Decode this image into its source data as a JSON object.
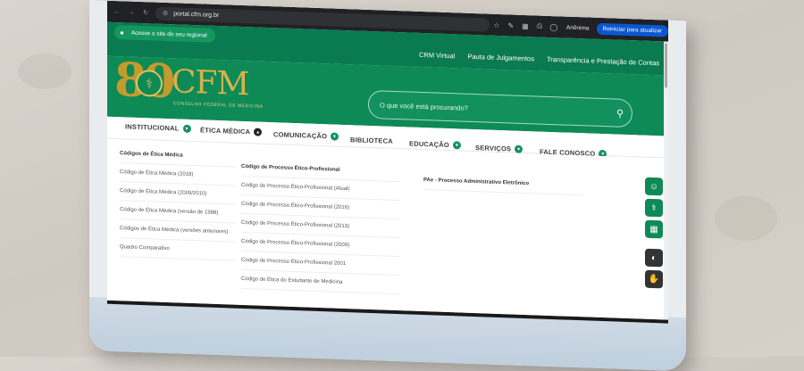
{
  "browser": {
    "url": "portal.cfm.org.br",
    "profile_label": "Anônima",
    "restart_label": "Reiniciar para atualizar"
  },
  "site": {
    "regional_label": "Acesse o site do seu regional",
    "top_links": [
      "CRM Virtual",
      "Pauta de Julgamentos",
      "Transparência e Prestação de Contas"
    ],
    "logo_number": "80",
    "logo_name": "CFM",
    "logo_subtitle": "CONSELHO FEDERAL DE MEDICINA",
    "search_placeholder": "O que você está procurando?"
  },
  "nav": {
    "items": [
      {
        "label": "INSTITUCIONAL",
        "has_chevron": true,
        "open": false
      },
      {
        "label": "ÉTICA MÉDICA",
        "has_chevron": true,
        "open": true
      },
      {
        "label": "COMUNICAÇÃO",
        "has_chevron": true,
        "open": false
      },
      {
        "label": "BIBLIOTECA",
        "has_chevron": false,
        "open": false
      },
      {
        "label": "EDUCAÇÃO",
        "has_chevron": true,
        "open": false
      },
      {
        "label": "SERVIÇOS",
        "has_chevron": true,
        "open": false
      },
      {
        "label": "FALE CONOSCO",
        "has_chevron": true,
        "open": false
      }
    ]
  },
  "dropdown": {
    "col1": {
      "header": "Códigos de Ética Médica",
      "items": [
        "Código de Ética Médica (2018)",
        "Código de Ética Médica (2009/2010)",
        "Código de Ética Médica (versão de 1988)",
        "Códigos de Ética Médica (versões anteriores)",
        "Quadro Comparativo"
      ]
    },
    "col2": {
      "header": "Código de Processo Ético-Profissional",
      "items": [
        "Código de Processo Ético-Profissional (Atual)",
        "Código de Processo Ético-Profissional (2016)",
        "Código de Processo Ético-Profissional (2013)",
        "Código de Processo Ético-Profissional (2009)",
        "Código de Processo Ético-Profissional 2001",
        "Código de Ética do Estudante de Medicina"
      ]
    },
    "col3": {
      "header": "PAe - Processo Administrativo Eletrônico"
    }
  },
  "colors": {
    "brand_green": "#0e8a57",
    "topbar_green": "#0a7a50",
    "gold": "#d9b14a",
    "chrome_dark": "#202124",
    "restart_blue": "#0b57d0"
  },
  "icons": {
    "side_widgets": [
      "user-stethoscope-icon",
      "stethoscope-icon",
      "building-icon",
      "contrast-icon",
      "sign-language-icon"
    ]
  }
}
